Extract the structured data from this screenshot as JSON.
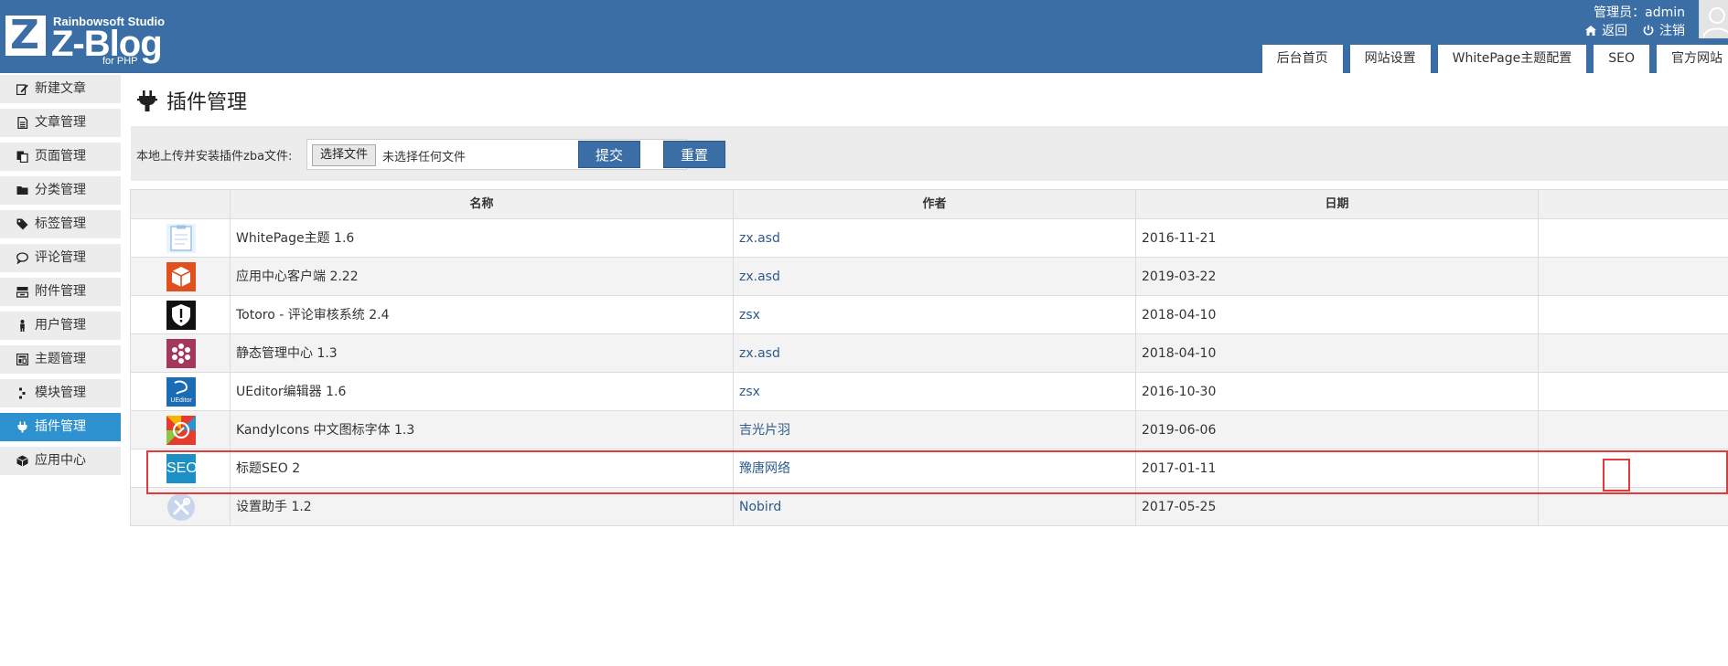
{
  "header": {
    "logo_studio": "Rainbowsoft Studio",
    "logo_name": "Z-Blog",
    "logo_sub": "for PHP",
    "admin_label": "管理员：admin",
    "back_label": "返回",
    "logout_label": "注销",
    "tabs": [
      "后台首页",
      "网站设置",
      "WhitePage主题配置",
      "SEO",
      "官方网站"
    ]
  },
  "sidebar": {
    "items": [
      {
        "label": "新建文章",
        "icon": "edit-icon"
      },
      {
        "label": "文章管理",
        "icon": "document-icon"
      },
      {
        "label": "页面管理",
        "icon": "pages-icon"
      },
      {
        "label": "分类管理",
        "icon": "folder-icon"
      },
      {
        "label": "标签管理",
        "icon": "tag-icon"
      },
      {
        "label": "评论管理",
        "icon": "comment-icon"
      },
      {
        "label": "附件管理",
        "icon": "attachment-icon"
      },
      {
        "label": "用户管理",
        "icon": "user-icon"
      },
      {
        "label": "主题管理",
        "icon": "theme-icon"
      },
      {
        "label": "模块管理",
        "icon": "module-icon"
      },
      {
        "label": "插件管理",
        "icon": "plugin-icon"
      },
      {
        "label": "应用中心",
        "icon": "app-center-icon"
      }
    ],
    "active_index": 10
  },
  "main": {
    "title": "插件管理",
    "upload_label": "本地上传并安装插件zba文件:",
    "file_button": "选择文件",
    "file_status": "未选择任何文件",
    "submit_label": "提交",
    "reset_label": "重置"
  },
  "table": {
    "headers": [
      "",
      "名称",
      "作者",
      "日期",
      ""
    ],
    "rows": [
      {
        "name": "WhitePage主题 1.6",
        "author": "zx.asd",
        "date": "2016-11-21",
        "icon": "whitepage-icon",
        "actions": [
          "settings"
        ]
      },
      {
        "name": "应用中心客户端 2.22",
        "author": "zx.asd",
        "date": "2019-03-22",
        "icon": "app-center-box-icon",
        "actions": [
          "power",
          "settings"
        ]
      },
      {
        "name": "Totoro - 评论审核系统 2.4",
        "author": "zsx",
        "date": "2018-04-10",
        "icon": "shield-icon",
        "actions": [
          "power",
          "settings"
        ]
      },
      {
        "name": "静态管理中心 1.3",
        "author": "zx.asd",
        "date": "2018-04-10",
        "icon": "flower-icon",
        "actions": [
          "power",
          "settings"
        ]
      },
      {
        "name": "UEditor编辑器 1.6",
        "author": "zsx",
        "date": "2016-10-30",
        "icon": "ueditor-icon",
        "actions": [
          "power"
        ]
      },
      {
        "name": "KandyIcons 中文图标字体 1.3",
        "author": "吉光片羽",
        "date": "2019-06-06",
        "icon": "kandyicons-icon",
        "actions": [
          "power",
          "settings"
        ]
      },
      {
        "name": "标题SEO 2",
        "author": "豫唐网络",
        "date": "2017-01-11",
        "icon": "seo-icon",
        "icon_text": "SEO",
        "actions": [
          "power",
          "settings"
        ]
      },
      {
        "name": "设置助手 1.2",
        "author": "Nobird",
        "date": "2017-05-25",
        "icon": "tools-icon",
        "actions": [
          "power-gray",
          "remove"
        ]
      }
    ]
  },
  "colors": {
    "header_bg": "#3a6ea5",
    "active_side": "#2e92d1",
    "highlight": "#e03a3a",
    "link": "#2d5a8c"
  }
}
